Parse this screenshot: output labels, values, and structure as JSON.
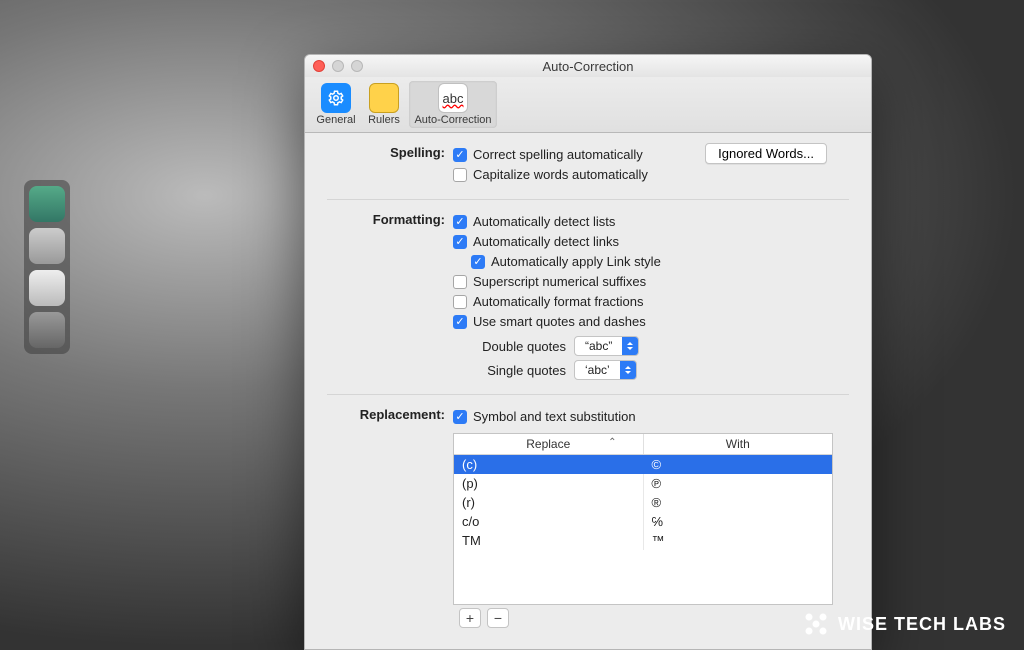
{
  "watermark": {
    "text": "WISE TECH LABS"
  },
  "window": {
    "title": "Auto-Correction",
    "toolbar": {
      "general": "General",
      "rulers": "Rulers",
      "autocorrection": "Auto-Correction",
      "ac_icon_text": "abc"
    },
    "sections": {
      "spelling": {
        "label": "Spelling:",
        "correct": {
          "label": "Correct spelling automatically",
          "checked": true
        },
        "capitalize": {
          "label": "Capitalize words automatically",
          "checked": false
        },
        "ignored_btn": "Ignored Words..."
      },
      "formatting": {
        "label": "Formatting:",
        "detect_lists": {
          "label": "Automatically detect lists",
          "checked": true
        },
        "detect_links": {
          "label": "Automatically detect links",
          "checked": true
        },
        "apply_link_style": {
          "label": "Automatically apply Link style",
          "checked": true
        },
        "superscript": {
          "label": "Superscript numerical suffixes",
          "checked": false
        },
        "fractions": {
          "label": "Automatically format fractions",
          "checked": false
        },
        "smart_quotes": {
          "label": "Use smart quotes and dashes",
          "checked": true
        },
        "double_quotes": {
          "label": "Double quotes",
          "value": "“abc”"
        },
        "single_quotes": {
          "label": "Single quotes",
          "value": "‘abc’"
        }
      },
      "replacement": {
        "label": "Replacement:",
        "symbol_sub": {
          "label": "Symbol and text substitution",
          "checked": true
        },
        "table": {
          "headers": {
            "replace": "Replace",
            "with": "With"
          },
          "rows": [
            {
              "replace": "(c)",
              "with": "©",
              "selected": true
            },
            {
              "replace": "(p)",
              "with": "℗",
              "selected": false
            },
            {
              "replace": "(r)",
              "with": "®",
              "selected": false
            },
            {
              "replace": "c/o",
              "with": "℅",
              "selected": false
            },
            {
              "replace": "TM",
              "with": "™",
              "selected": false
            }
          ]
        },
        "add_btn": "+",
        "remove_btn": "−"
      }
    }
  }
}
